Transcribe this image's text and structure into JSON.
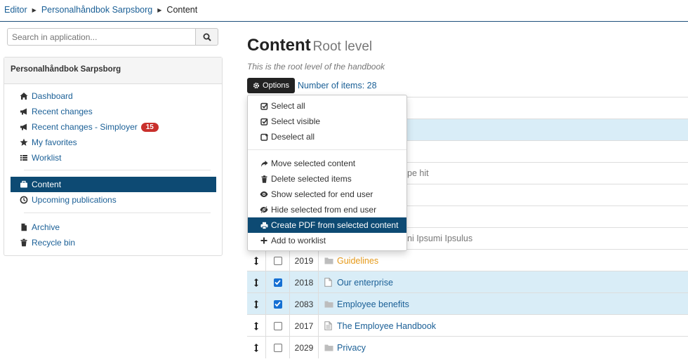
{
  "breadcrumb": [
    "Editor",
    "Personalhåndbok Sarpsborg",
    "Content"
  ],
  "search": {
    "placeholder": "Search in application..."
  },
  "sidebar": {
    "title": "Personalhåndbok Sarpsborg",
    "items": [
      {
        "label": "Dashboard",
        "icon": "home-icon"
      },
      {
        "label": "Recent changes",
        "icon": "megaphone-icon"
      },
      {
        "label": "Recent changes - Simployer",
        "icon": "megaphone-icon",
        "badge": "15"
      },
      {
        "label": "My favorites",
        "icon": "star-icon"
      },
      {
        "label": "Worklist",
        "icon": "list-icon"
      },
      {
        "label": "Content",
        "icon": "briefcase-icon",
        "active": true
      },
      {
        "label": "Upcoming publications",
        "icon": "clock-icon"
      },
      {
        "label": "Archive",
        "icon": "file-icon"
      },
      {
        "label": "Recycle bin",
        "icon": "trash-icon"
      }
    ]
  },
  "main": {
    "title": "Content",
    "subtitle": "Root level",
    "description": "This is the root level of the handbook",
    "options_label": "Options",
    "count_label": "Number of items: 28"
  },
  "menu": {
    "items": [
      "Select all",
      "Select visible",
      "Deselect all",
      "Move selected content",
      "Delete selected items",
      "Show selected for end user",
      "Hide selected from end user",
      "Create PDF from selected content",
      "Add to worklist"
    ]
  },
  "peek": {
    "row_a": "pe hit",
    "row_b": "ni Ipsumi Ipsulus"
  },
  "table": {
    "rows": [
      {
        "id": "2019",
        "title": "Guidelines",
        "type": "folder",
        "checked": false
      },
      {
        "id": "2018",
        "title": "Our enterprise",
        "type": "document",
        "checked": true
      },
      {
        "id": "2083",
        "title": "Employee benefits",
        "type": "folder",
        "checked": true
      },
      {
        "id": "2017",
        "title": "The Employee Handbook",
        "type": "document",
        "checked": false
      },
      {
        "id": "2029",
        "title": "Privacy",
        "type": "folder",
        "checked": false
      }
    ]
  },
  "colors": {
    "accent": "#0d4a73",
    "link": "#1a5f96",
    "badge": "#c9302c",
    "selected_row": "#d9edf7",
    "orange_link": "#e69a1a"
  }
}
